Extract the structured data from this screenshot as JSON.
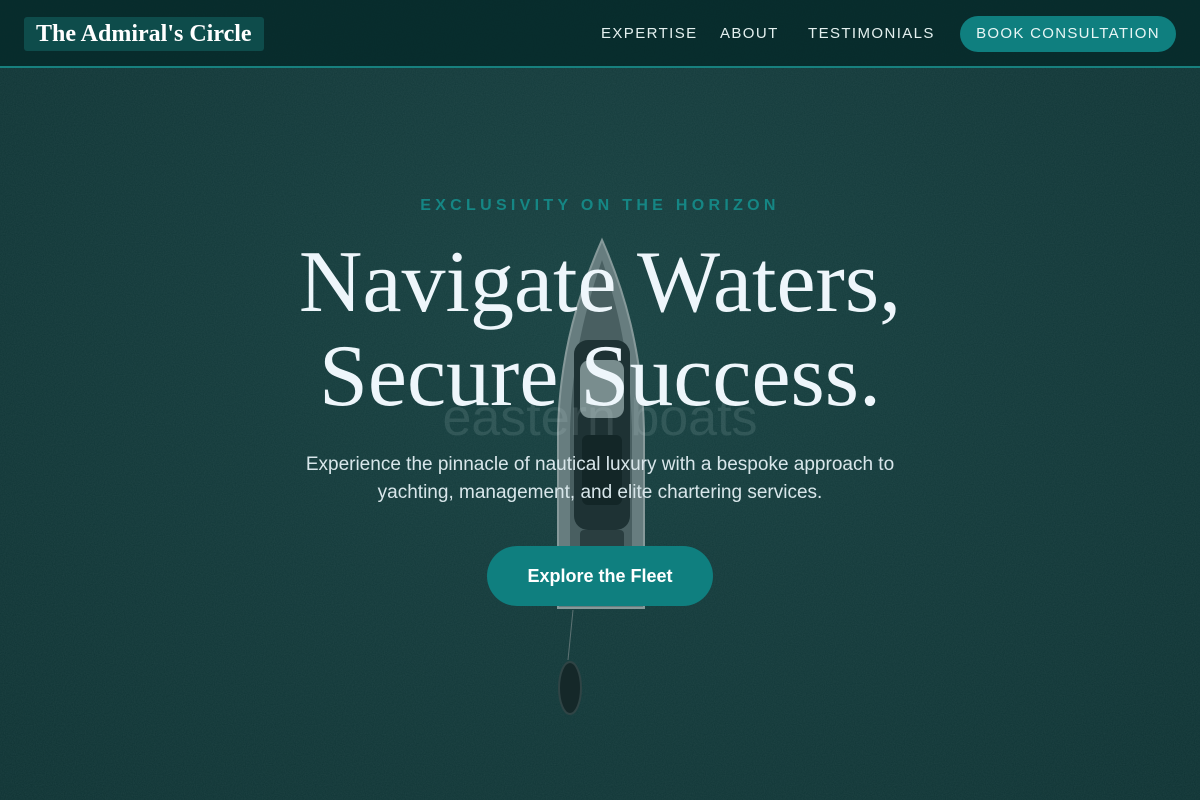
{
  "header": {
    "logo_text": "The Admiral's Circle",
    "nav": [
      {
        "label": "EXPERTISE"
      },
      {
        "label": "ABOUT"
      },
      {
        "label": "TESTIMONIALS"
      }
    ],
    "cta_label": "BOOK CONSULTATION"
  },
  "hero": {
    "eyebrow": "EXCLUSIVITY ON THE HORIZON",
    "headline_line1": "Navigate Waters,",
    "headline_line2": "Secure Success.",
    "ghost_text": "eastern boats",
    "subtitle": "Experience the pinnacle of nautical luxury with a bespoke approach to yachting, management, and elite chartering services.",
    "cta_label": "Explore the Fleet"
  },
  "colors": {
    "accent": "#0f7f7f",
    "header_bg": "#062a2a",
    "water": "#183f40",
    "eyebrow": "#158684",
    "headline": "#eef6fb"
  },
  "icons": {
    "background": "yacht-aerial-image"
  }
}
